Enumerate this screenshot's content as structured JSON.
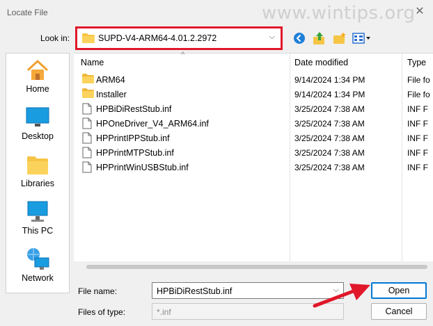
{
  "window": {
    "title": "Locate File",
    "watermark": "www.wintips.org"
  },
  "lookin": {
    "label": "Look in:",
    "value": "SUPD-V4-ARM64-4.01.2.2972"
  },
  "toolbar": {
    "icons": [
      "back-icon",
      "up-folder-icon",
      "new-folder-icon",
      "view-menu-icon"
    ]
  },
  "places": [
    {
      "label": "Home",
      "icon": "home-icon"
    },
    {
      "label": "Desktop",
      "icon": "desktop-icon"
    },
    {
      "label": "Libraries",
      "icon": "libraries-icon"
    },
    {
      "label": "This PC",
      "icon": "this-pc-icon"
    },
    {
      "label": "Network",
      "icon": "network-icon"
    }
  ],
  "columns": {
    "name": "Name",
    "date": "Date modified",
    "type": "Type"
  },
  "files": [
    {
      "name": "ARM64",
      "date": "9/14/2024 1:34 PM",
      "type": "File fo",
      "kind": "folder"
    },
    {
      "name": "Installer",
      "date": "9/14/2024 1:34 PM",
      "type": "File fo",
      "kind": "folder"
    },
    {
      "name": "HPBiDiRestStub.inf",
      "date": "3/25/2024 7:38 AM",
      "type": "INF F",
      "kind": "file"
    },
    {
      "name": "HPOneDriver_V4_ARM64.inf",
      "date": "3/25/2024 7:38 AM",
      "type": "INF F",
      "kind": "file"
    },
    {
      "name": "HPPrintIPPStub.inf",
      "date": "3/25/2024 7:38 AM",
      "type": "INF F",
      "kind": "file"
    },
    {
      "name": "HPPrintMTPStub.inf",
      "date": "3/25/2024 7:38 AM",
      "type": "INF F",
      "kind": "file"
    },
    {
      "name": "HPPrintWinUSBStub.inf",
      "date": "3/25/2024 7:38 AM",
      "type": "INF F",
      "kind": "file"
    }
  ],
  "filename": {
    "label": "File name:",
    "value": "HPBiDiRestStub.inf"
  },
  "filetype": {
    "label": "Files of type:",
    "value": "*.inf"
  },
  "buttons": {
    "open": "Open",
    "cancel": "Cancel"
  },
  "colors": {
    "highlight_border": "#e0182a",
    "accent": "#0078d4",
    "folder": "#f6c545"
  }
}
